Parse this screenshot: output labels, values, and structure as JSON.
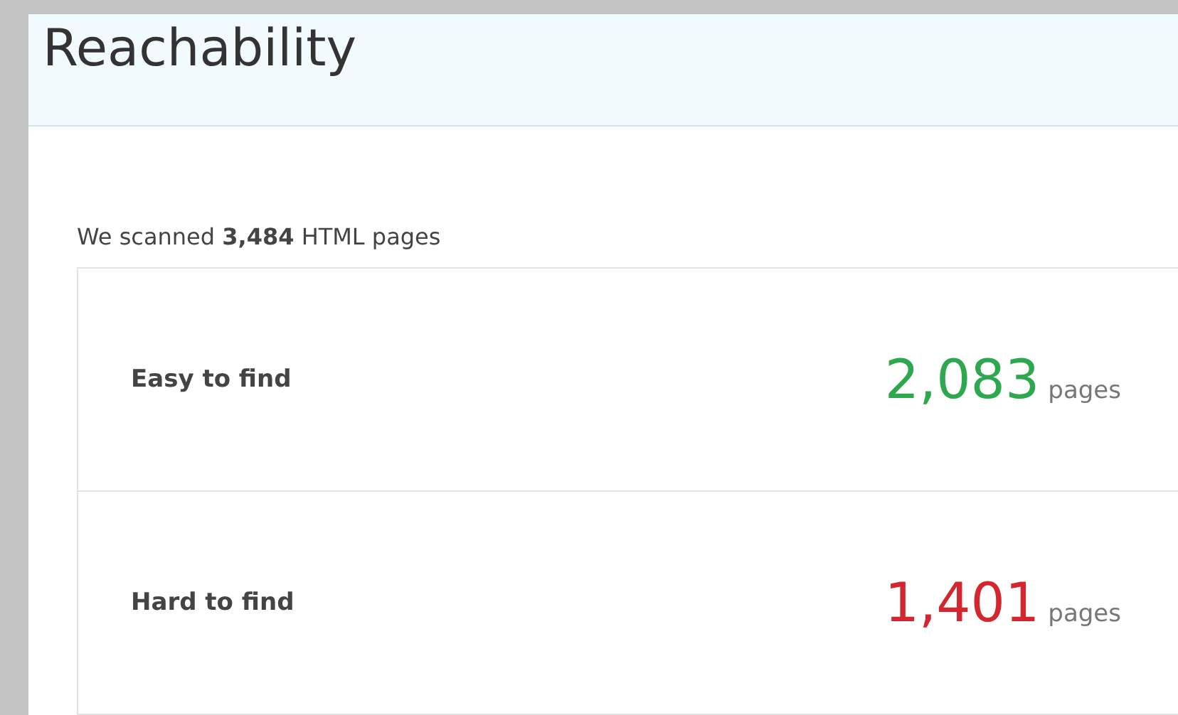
{
  "panel": {
    "title": "Reachability"
  },
  "summary": "We scanned **3,484** HTML pages",
  "stats": [
    {
      "label": "Easy to find",
      "value": "2,083",
      "unit": "pages",
      "color": "#2ea84f"
    },
    {
      "label": "Hard to find",
      "value": "1,401",
      "unit": "pages",
      "color": "#d3262f"
    }
  ]
}
